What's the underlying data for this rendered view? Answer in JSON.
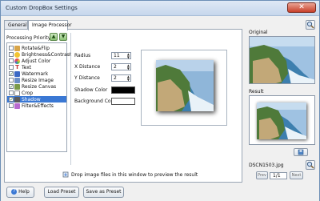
{
  "window": {
    "title": "Custom DropBox Settings"
  },
  "tabs": [
    {
      "label": "General"
    },
    {
      "label": "Image Processor"
    }
  ],
  "processing": {
    "label": "Processing Priority",
    "items": [
      {
        "label": "Rotate&Flip",
        "checked": false,
        "icon_color": "#d8a54a"
      },
      {
        "label": "Brightness&Contrast",
        "checked": false,
        "icon_color": "#f2c431"
      },
      {
        "label": "Adjust Color",
        "checked": false,
        "icon_color": "#e04a7a"
      },
      {
        "label": "Text",
        "checked": false,
        "icon_color": "#c43a3a"
      },
      {
        "label": "Watermark",
        "checked": true,
        "icon_color": "#3a68c4"
      },
      {
        "label": "Resize Image",
        "checked": false,
        "icon_color": "#6b8fc6"
      },
      {
        "label": "Resize Canvas",
        "checked": true,
        "icon_color": "#7b9a4a"
      },
      {
        "label": "Crop",
        "checked": false,
        "icon_color": "#888888"
      },
      {
        "label": "Shadow",
        "checked": true,
        "icon_color": "#5a5a5a",
        "selected": true
      },
      {
        "label": "Filter&Effects",
        "checked": false,
        "icon_color": "#b86bd0"
      }
    ]
  },
  "shadow": {
    "radius_label": "Radius",
    "radius_value": "11",
    "x_label": "X Distance",
    "x_value": "2",
    "y_label": "Y Distance",
    "y_value": "2",
    "color_label": "Shadow Color",
    "color": "#000000",
    "bg_label": "Background Color",
    "bg_color": "#ffffff"
  },
  "drop_hint": "Drop image files in this window to preview the result",
  "right": {
    "original_label": "Original",
    "result_label": "Result",
    "filename": "DSCN1503.jpg",
    "prev_label": "Prev",
    "page_value": "1/1",
    "next_label": "Next"
  },
  "buttons": {
    "help": "Help",
    "load_preset": "Load Preset",
    "save_preset": "Save as Preset",
    "close_glyph": "✕"
  },
  "colors": {
    "accent": "#3a78d4",
    "selection": "#3a78d4",
    "close": "#c8402a"
  }
}
